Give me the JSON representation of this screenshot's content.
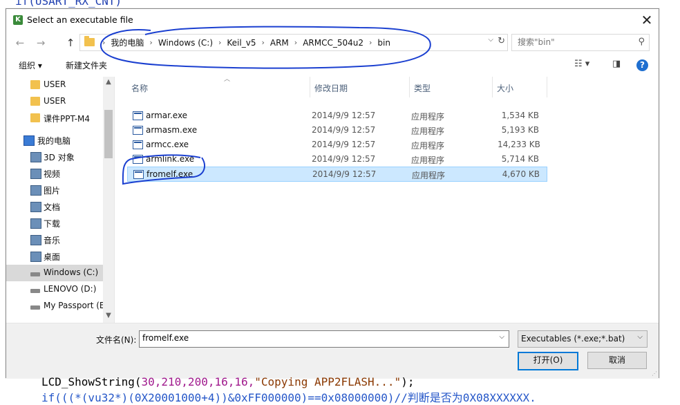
{
  "background_code": {
    "top_line": "if(USART_RX_CNT)",
    "line1": {
      "func": "LCD_ShowString(",
      "args": "30,210,200,16,16,",
      "str": "\"Copying APP2FLASH...\"",
      "end": ");"
    },
    "line2": "if(((*(vu32*)(0X20001000+4))&0xFF000000)==0x08000000)//判断是否为0X08XXXXXX."
  },
  "dialog": {
    "title": "Select an executable file",
    "close_glyph": "✕",
    "nav": {
      "back": "←",
      "forward": "→",
      "up": "↑",
      "breadcrumbs": [
        "我的电脑",
        "Windows (C:)",
        "Keil_v5",
        "ARM",
        "ARMCC_504u2",
        "bin"
      ],
      "separator": "›",
      "search_placeholder": "搜索\"bin\""
    },
    "toolbar": {
      "organize": "组织 ▾",
      "new_folder": "新建文件夹",
      "view_glyph": "☷ ▾",
      "pane_glyph": "◨",
      "help_glyph": "?"
    },
    "sidebar": {
      "items": [
        {
          "label": "USER",
          "icon": "folder-icon",
          "kind": "folder",
          "indent": 1
        },
        {
          "label": "USER",
          "icon": "folder-icon",
          "kind": "folder",
          "indent": 1
        },
        {
          "label": "课件PPT-M4",
          "icon": "folder-icon",
          "kind": "folder",
          "indent": 1
        },
        {
          "label": "我的电脑",
          "icon": "computer-icon",
          "kind": "pc",
          "indent": 0
        },
        {
          "label": "3D 对象",
          "icon": "3d-objects-icon",
          "kind": "gen",
          "indent": 1
        },
        {
          "label": "视频",
          "icon": "video-icon",
          "kind": "gen",
          "indent": 1
        },
        {
          "label": "图片",
          "icon": "pictures-icon",
          "kind": "gen",
          "indent": 1
        },
        {
          "label": "文档",
          "icon": "documents-icon",
          "kind": "gen",
          "indent": 1
        },
        {
          "label": "下载",
          "icon": "downloads-icon",
          "kind": "gen",
          "indent": 1
        },
        {
          "label": "音乐",
          "icon": "music-icon",
          "kind": "gen",
          "indent": 1
        },
        {
          "label": "桌面",
          "icon": "desktop-icon",
          "kind": "gen",
          "indent": 1
        },
        {
          "label": "Windows (C:)",
          "icon": "drive-icon",
          "kind": "drive",
          "indent": 1,
          "selected": true
        },
        {
          "label": "LENOVO (D:)",
          "icon": "drive-icon",
          "kind": "drive",
          "indent": 1
        },
        {
          "label": "My Passport (E",
          "icon": "drive-icon",
          "kind": "drive",
          "indent": 1
        }
      ]
    },
    "columns": [
      "名称",
      "修改日期",
      "类型",
      "大小"
    ],
    "files": [
      {
        "name": "armar.exe",
        "date": "2014/9/9 12:57",
        "type": "应用程序",
        "size": "1,534 KB"
      },
      {
        "name": "armasm.exe",
        "date": "2014/9/9 12:57",
        "type": "应用程序",
        "size": "5,193 KB"
      },
      {
        "name": "armcc.exe",
        "date": "2014/9/9 12:57",
        "type": "应用程序",
        "size": "14,233 KB"
      },
      {
        "name": "armlink.exe",
        "date": "2014/9/9 12:57",
        "type": "应用程序",
        "size": "5,714 KB"
      },
      {
        "name": "fromelf.exe",
        "date": "2014/9/9 12:57",
        "type": "应用程序",
        "size": "4,670 KB",
        "selected": true
      }
    ],
    "footer": {
      "filename_label": "文件名(N):",
      "filename_value": "fromelf.exe",
      "filter": "Executables (*.exe;*.bat)",
      "open_button": "打开(O)",
      "cancel_button": "取消"
    }
  },
  "colors": {
    "selection_bg": "#cce8ff",
    "selection_border": "#99d1ff",
    "annotation_ink": "#1a3fd0",
    "primary_button_border": "#0078d7"
  }
}
